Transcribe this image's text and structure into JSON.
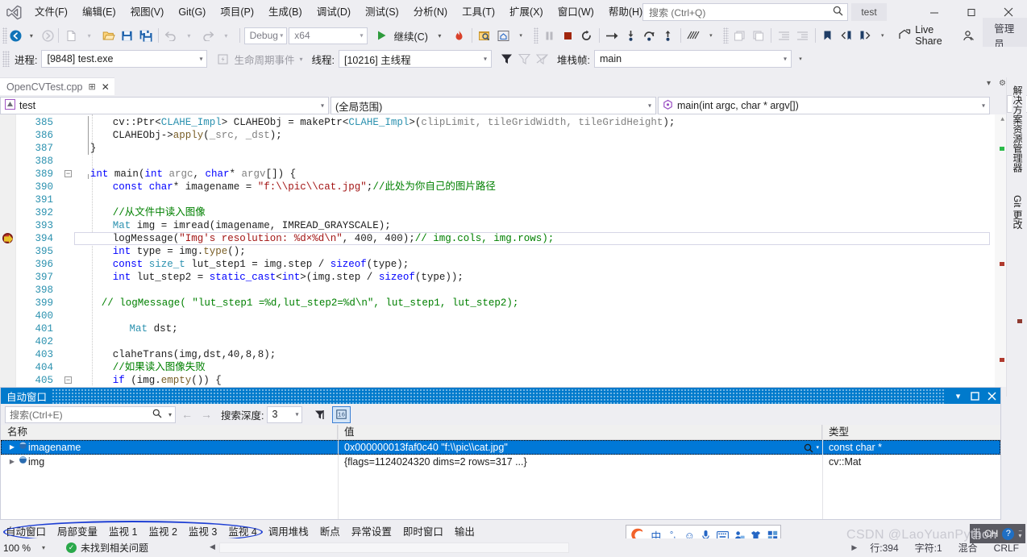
{
  "app": {
    "window_title": "test",
    "logo_icon": "visual-studio-logo"
  },
  "menu": {
    "items": [
      {
        "label": "文件(F)"
      },
      {
        "label": "编辑(E)"
      },
      {
        "label": "视图(V)"
      },
      {
        "label": "Git(G)"
      },
      {
        "label": "项目(P)"
      },
      {
        "label": "生成(B)"
      },
      {
        "label": "调试(D)"
      },
      {
        "label": "测试(S)"
      },
      {
        "label": "分析(N)"
      },
      {
        "label": "工具(T)"
      },
      {
        "label": "扩展(X)"
      },
      {
        "label": "窗口(W)"
      },
      {
        "label": "帮助(H)"
      }
    ]
  },
  "search": {
    "placeholder": "搜索 (Ctrl+Q)",
    "icon": "search-icon"
  },
  "window_controls": {
    "minimize": "–",
    "maximize": "❐",
    "close": "✕"
  },
  "toolbar": {
    "back_icon": "navigate-back-icon",
    "forward_icon": "navigate-forward-icon",
    "new_icon": "new-file-icon",
    "open_icon": "open-file-icon",
    "save_icon": "save-icon",
    "save_all_icon": "save-all-icon",
    "undo_icon": "undo-icon",
    "redo_icon": "redo-icon",
    "config_value": "Debug",
    "platform_value": "x64",
    "continue_label": "继续(C)",
    "continue_icon": "play-icon",
    "hot_reload_icon": "hot-reload-icon",
    "attach_icon": "attach-to-process-icon",
    "home_icon": "home-icon",
    "pause_icon": "pause-icon",
    "stop_icon": "stop-icon",
    "restart_icon": "restart-icon",
    "show_next_statement_icon": "show-next-statement-icon",
    "step_into_icon": "step-into-icon",
    "step_over_icon": "step-over-icon",
    "step_out_icon": "step-out-icon",
    "diff_icon": "compare-icon",
    "comment_icon": "comment-icon",
    "uncomment_icon": "uncomment-icon",
    "indent_icon": "increase-indent-icon",
    "outdent_icon": "decrease-indent-icon",
    "bookmark_icon": "bookmark-icon",
    "prev_bookmark_icon": "previous-bookmark-icon",
    "next_bookmark_icon": "next-bookmark-icon",
    "live_share_label": "Live Share",
    "live_share_icon": "live-share-icon",
    "feedback_icon": "send-feedback-icon",
    "admin_label": "管理员"
  },
  "debug_bar": {
    "process_label": "进程:",
    "process_value": "[9848] test.exe",
    "lifecycle_label": "生命周期事件",
    "lifecycle_icon": "lifecycle-events-icon",
    "thread_label": "线程:",
    "thread_value": "[10216] 主线程",
    "stackframe_label": "堆栈帧:",
    "stackframe_value": "main",
    "filter_icon": "filter-icon",
    "filter2_icon": "filter-clear-icon",
    "filter3_icon": "no-filter-icon"
  },
  "document_tab": {
    "title": "OpenCVTest.cpp",
    "pin_icon": "pin-icon",
    "close_icon": "close-icon"
  },
  "nav_bar": {
    "project": "test",
    "project_icon": "project-icon",
    "scope": "(全局范围)",
    "member": "main(int argc, char * argv[])",
    "member_icon": "method-icon",
    "split_icon": "split-editor-icon"
  },
  "editor": {
    "breakpoint_line": 394,
    "current_statement_line": 394,
    "lines": [
      {
        "num": 385,
        "indent": 6,
        "tokens": [
          {
            "t": "cv",
            "c": "n"
          },
          {
            "t": "::",
            "c": "n"
          },
          {
            "t": "Ptr",
            "c": "n"
          },
          {
            "t": "<",
            "c": "n"
          },
          {
            "t": "CLAHE_Impl",
            "c": "t"
          },
          {
            "t": "> CLAHEObj = ",
            "c": "n"
          },
          {
            "t": "makePtr",
            "c": "n"
          },
          {
            "t": "<",
            "c": "n"
          },
          {
            "t": "CLAHE_Impl",
            "c": "t"
          },
          {
            "t": ">(",
            "c": "n"
          },
          {
            "t": "clipLimit, tileGridWidth, tileGridHeight",
            "c": "gray"
          },
          {
            "t": ");",
            "c": "n"
          }
        ]
      },
      {
        "num": 386,
        "indent": 6,
        "tokens": [
          {
            "t": "CLAHEObj->",
            "c": "n"
          },
          {
            "t": "apply",
            "c": "f"
          },
          {
            "t": "(",
            "c": "n"
          },
          {
            "t": "_src, _dst",
            "c": "gray"
          },
          {
            "t": ");",
            "c": "n"
          }
        ]
      },
      {
        "num": 387,
        "indent": 2,
        "tokens": [
          {
            "t": "}",
            "c": "n"
          }
        ]
      },
      {
        "num": 388,
        "indent": 0,
        "tokens": []
      },
      {
        "num": 389,
        "indent": 2,
        "fold": true,
        "tokens": [
          {
            "t": "int",
            "c": "k"
          },
          {
            "t": " ",
            "c": "n"
          },
          {
            "t": "main",
            "c": "n"
          },
          {
            "t": "(",
            "c": "n"
          },
          {
            "t": "int",
            "c": "k"
          },
          {
            "t": " ",
            "c": "n"
          },
          {
            "t": "argc",
            "c": "gray"
          },
          {
            "t": ", ",
            "c": "n"
          },
          {
            "t": "char",
            "c": "k"
          },
          {
            "t": "* ",
            "c": "n"
          },
          {
            "t": "argv",
            "c": "gray"
          },
          {
            "t": "[]) {",
            "c": "n"
          }
        ]
      },
      {
        "num": 390,
        "indent": 6,
        "tokens": [
          {
            "t": "const",
            "c": "k"
          },
          {
            "t": " ",
            "c": "n"
          },
          {
            "t": "char",
            "c": "k"
          },
          {
            "t": "* imagename = ",
            "c": "n"
          },
          {
            "t": "\"f:\\\\pic\\\\cat.jpg\"",
            "c": "s"
          },
          {
            "t": ";",
            "c": "n"
          },
          {
            "t": "//此处为你自己的图片路径",
            "c": "c"
          }
        ]
      },
      {
        "num": 391,
        "indent": 0,
        "tokens": []
      },
      {
        "num": 392,
        "indent": 6,
        "tokens": [
          {
            "t": "//从文件中读入图像",
            "c": "c"
          }
        ]
      },
      {
        "num": 393,
        "indent": 6,
        "tokens": [
          {
            "t": "Mat",
            "c": "t"
          },
          {
            "t": " img = ",
            "c": "n"
          },
          {
            "t": "imread",
            "c": "n"
          },
          {
            "t": "(",
            "c": "n"
          },
          {
            "t": "imagename, IMREAD_GRAYSCALE",
            "c": "n"
          },
          {
            "t": ");",
            "c": "n"
          }
        ]
      },
      {
        "num": 394,
        "indent": 6,
        "tokens": [
          {
            "t": "logMessage",
            "c": "n"
          },
          {
            "t": "(",
            "c": "n"
          },
          {
            "t": "\"Img's resolution: %d×%d\\n\"",
            "c": "s"
          },
          {
            "t": ", 400, 400);",
            "c": "n"
          },
          {
            "t": "// img.cols, img.rows);",
            "c": "c"
          }
        ]
      },
      {
        "num": 395,
        "indent": 6,
        "tokens": [
          {
            "t": "int",
            "c": "k"
          },
          {
            "t": " type = img.",
            "c": "n"
          },
          {
            "t": "type",
            "c": "f"
          },
          {
            "t": "();",
            "c": "n"
          }
        ]
      },
      {
        "num": 396,
        "indent": 6,
        "tokens": [
          {
            "t": "const",
            "c": "k"
          },
          {
            "t": " ",
            "c": "n"
          },
          {
            "t": "size_t",
            "c": "t"
          },
          {
            "t": " lut_step1 = img.step / ",
            "c": "n"
          },
          {
            "t": "sizeof",
            "c": "k"
          },
          {
            "t": "(type);",
            "c": "n"
          }
        ]
      },
      {
        "num": 397,
        "indent": 6,
        "tokens": [
          {
            "t": "int",
            "c": "k"
          },
          {
            "t": " lut_step2 = ",
            "c": "n"
          },
          {
            "t": "static_cast",
            "c": "k"
          },
          {
            "t": "<",
            "c": "n"
          },
          {
            "t": "int",
            "c": "k"
          },
          {
            "t": ">(img.step / ",
            "c": "n"
          },
          {
            "t": "sizeof",
            "c": "k"
          },
          {
            "t": "(type));",
            "c": "n"
          }
        ]
      },
      {
        "num": 398,
        "indent": 0,
        "tokens": []
      },
      {
        "num": 399,
        "indent": 4,
        "tokens": [
          {
            "t": "// logMessage( \"lut_step1 =%d,lut_step2=%d\\n\", lut_step1, lut_step2);",
            "c": "c"
          }
        ]
      },
      {
        "num": 400,
        "indent": 0,
        "tokens": []
      },
      {
        "num": 401,
        "indent": 9,
        "tokens": [
          {
            "t": "Mat",
            "c": "t"
          },
          {
            "t": " dst;",
            "c": "n"
          }
        ]
      },
      {
        "num": 402,
        "indent": 0,
        "tokens": []
      },
      {
        "num": 403,
        "indent": 6,
        "tokens": [
          {
            "t": "claheTrans(img,dst,40,8,8);",
            "c": "n"
          }
        ]
      },
      {
        "num": 404,
        "indent": 6,
        "tokens": [
          {
            "t": "//如果读入图像失败",
            "c": "c"
          }
        ]
      },
      {
        "num": 405,
        "indent": 6,
        "fold": true,
        "tokens": [
          {
            "t": "if",
            "c": "k"
          },
          {
            "t": " (img.",
            "c": "n"
          },
          {
            "t": "empty",
            "c": "f"
          },
          {
            "t": "()) {",
            "c": "n"
          }
        ]
      }
    ]
  },
  "autos_panel": {
    "title": "自动窗口",
    "float_icon": "float-icon",
    "dropdown_icon": "window-menu-icon",
    "maximize_icon": "maximize-icon",
    "close_icon": "close-icon",
    "search_placeholder": "搜索(Ctrl+E)",
    "search_icon": "search-icon",
    "search_dropdown_icon": "chevron-down-icon",
    "prev_icon": "previous-icon",
    "next_icon": "next-icon",
    "depth_label": "搜索深度:",
    "depth_value": "3",
    "pin_tool_icon": "pin-column-icon",
    "hex_tool_icon": "hexadecimal-display-icon",
    "columns": [
      "名称",
      "值",
      "类型"
    ],
    "rows": [
      {
        "name": "imagename",
        "value": "0x000000013faf0c40 \"f:\\\\pic\\\\cat.jpg\"",
        "type": "const char *",
        "selected": true,
        "expandable": true,
        "icon": "variable-icon",
        "magnifier_icon": "text-visualizer-icon"
      },
      {
        "name": "img",
        "value": "{flags=1124024320 dims=2 rows=317 ...}",
        "type": "cv::Mat",
        "selected": false,
        "expandable": true,
        "icon": "variable-icon"
      }
    ]
  },
  "bottom_tabs": {
    "items": [
      {
        "label": "自动窗口",
        "active": true
      },
      {
        "label": "局部变量",
        "active": false
      },
      {
        "label": "监视 1",
        "active": false
      },
      {
        "label": "监视 2",
        "active": false
      },
      {
        "label": "监视 3",
        "active": false
      },
      {
        "label": "监视 4",
        "active": false
      },
      {
        "label": "调用堆栈",
        "active": false
      },
      {
        "label": "断点",
        "active": false
      },
      {
        "label": "异常设置",
        "active": false
      },
      {
        "label": "即时窗口",
        "active": false
      },
      {
        "label": "输出",
        "active": false
      }
    ],
    "annotation_color": "#1e3fd4"
  },
  "status_bar": {
    "zoom": "100 %",
    "issues_text": "未找到相关问题",
    "issues_icon": "check-circle-icon",
    "line": "行:394",
    "column": "字符:1",
    "insert_mode": "混合",
    "line_ending": "CRLF"
  },
  "ime_bar": {
    "logo_icon": "sogou-logo-icon",
    "mode_label": "中",
    "punct_icon": "punctuation-icon",
    "emoji_icon": "emoji-icon",
    "voice_icon": "microphone-icon",
    "keyboard_icon": "soft-keyboard-icon",
    "user_icon": "user-icon",
    "skin_icon": "skin-icon",
    "apps_icon": "toolbox-icon"
  },
  "tray": {
    "lang_label": "CH",
    "help_icon": "help-icon",
    "grip_icon": "drag-grip-icon"
  },
  "right_dock": {
    "gear_icon": "settings-icon",
    "split_icon": "split-icon",
    "collapse_icon": "collapse-icon",
    "tabs": [
      {
        "label": "解决方案资源管理器"
      },
      {
        "label": "Git 更改"
      }
    ]
  },
  "watermark": {
    "text": "CSDN @LaoYuanPython"
  },
  "colors": {
    "accent": "#007acc",
    "selection": "#0078d7",
    "keyword": "#0000ff",
    "type": "#2b91af",
    "string": "#a31515",
    "comment": "#008000",
    "linenumber": "#2b91af",
    "breakpoint": "#c4342a",
    "annotation": "#1e3fd4"
  }
}
